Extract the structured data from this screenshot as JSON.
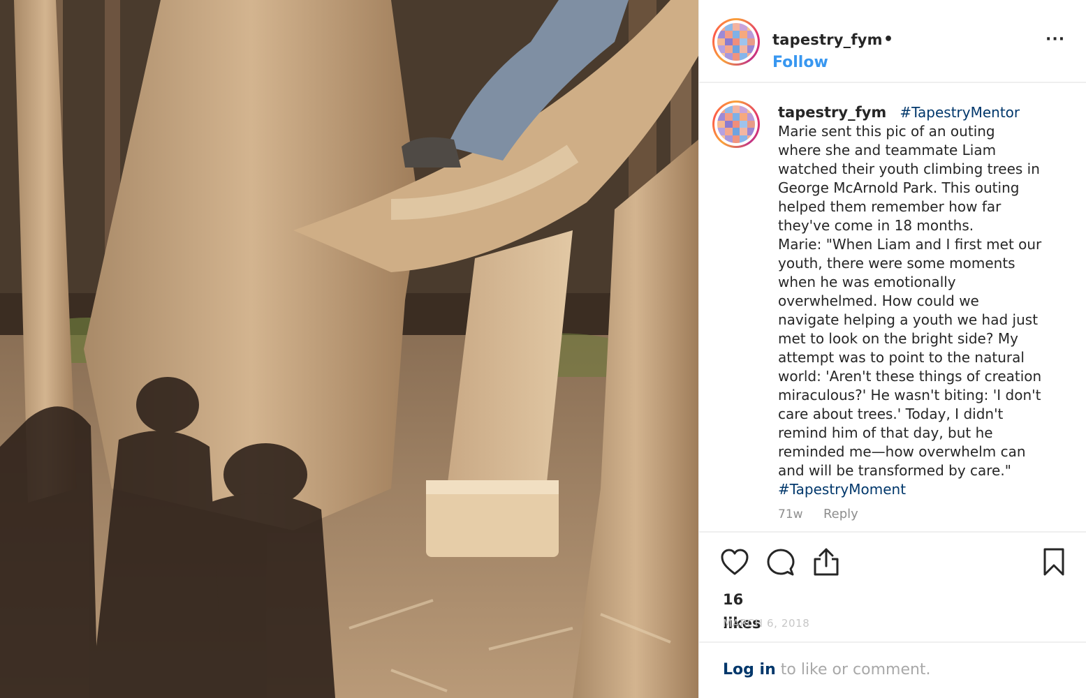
{
  "post": {
    "image_alt": "",
    "header": {
      "username": "tapestry_fym",
      "dot": "•",
      "follow_label": "Follow",
      "more_label": "···"
    },
    "caption": {
      "username": "tapestry_fym",
      "hashtag_top": "#TapestryMentor",
      "lines": [
        "Marie sent this pic of an outing",
        "where she and teammate Liam",
        "watched their youth climbing trees in",
        "George McArnold Park. This outing",
        "helped them remember how far",
        "they've come in 18 months.",
        "Marie: \"When Liam and I first met our",
        "youth, there were some moments",
        "when he was emotionally",
        "overwhelmed. How could we",
        "navigate helping a youth we had just",
        "met to look on the bright side? My",
        "attempt was to point to the natural",
        "world: 'Aren't these things of creation",
        "miraculous?' He wasn't biting: 'I don't",
        "care about trees.' Today, I didn't",
        "remind him of that day, but he",
        "reminded me—how overwhelm can",
        "and will be transformed by care.\""
      ],
      "hashtag_bottom": "#TapestryMoment",
      "age": "71w",
      "reply_label": "Reply"
    },
    "actions": {
      "like_icon": "heart-icon",
      "comment_icon": "comment-icon",
      "share_icon": "share-icon",
      "save_icon": "bookmark-icon"
    },
    "likes_count": "16",
    "likes_label": "likes",
    "date": "MARCH 6, 2018",
    "login_link": "Log in",
    "login_suffix": " to like or comment."
  },
  "colors": {
    "link_blue": "#3897f0",
    "hashtag": "#00376b",
    "muted": "#8e8e8e",
    "divider": "#efefef"
  }
}
